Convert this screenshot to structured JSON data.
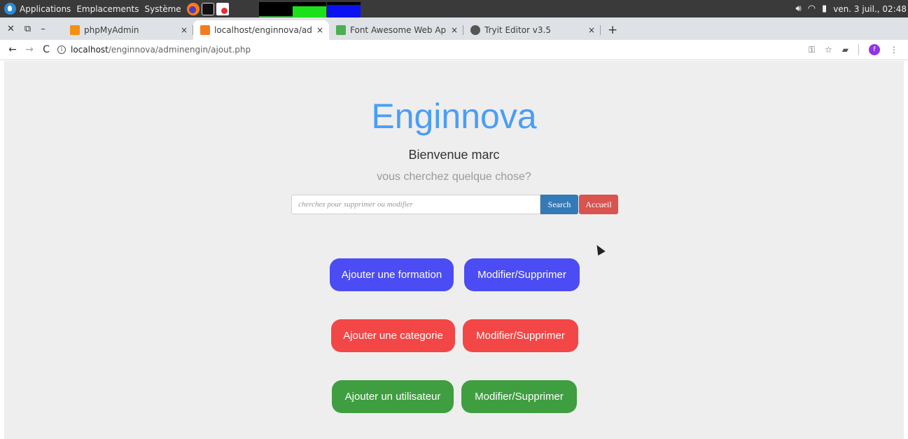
{
  "system_panel": {
    "menus": [
      "Applications",
      "Emplacements",
      "Système"
    ],
    "clock": "ven. 3 juil., 02:48"
  },
  "tabs": [
    {
      "title": "phpMyAdmin",
      "favicon_color": "#f29111"
    },
    {
      "title": "localhost/enginnova/admin",
      "favicon_color": "#f47b20"
    },
    {
      "title": "Font Awesome Web Applic",
      "favicon_color": "#4caf50"
    },
    {
      "title": "Tryit Editor v3.5",
      "favicon_color": "#555555"
    }
  ],
  "tab_close": "×",
  "address_bar": {
    "host": "localhost",
    "path": "/enginnova/adminengin/ajout.php"
  },
  "page": {
    "brand": "Enginnova",
    "welcome": "Bienvenue marc",
    "subtitle": "vous cherchez quelque chose?",
    "search_placeholder": "cherchez pour supprimer ou modifier",
    "search_value": "",
    "search_button": "Search",
    "home_button": "Accueil",
    "actions": {
      "formation": {
        "add": "Ajouter une formation",
        "edit": "Modifier/Supprimer",
        "color": "#4b4cf3"
      },
      "categorie": {
        "add": "Ajouter une categorie",
        "edit": "Modifier/Supprimer",
        "color": "#f34646"
      },
      "utilisateur": {
        "add": "Ajouter un utilisateur",
        "edit": "Modifier/Supprimer",
        "color": "#3f9e40"
      }
    }
  },
  "profile_initial": "f"
}
